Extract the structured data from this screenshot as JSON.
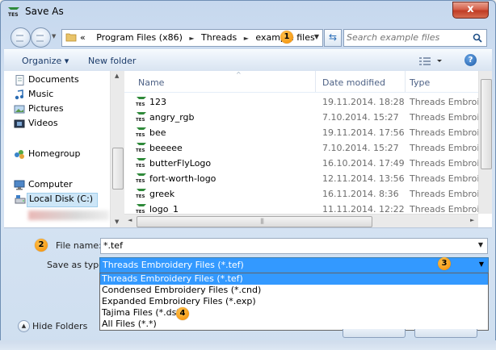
{
  "window": {
    "title": "Save As",
    "close_label": "x"
  },
  "address": {
    "overflow": "«",
    "crumbs": [
      "Program Files (x86)",
      "Threads",
      "example files"
    ],
    "separator": "►"
  },
  "search": {
    "placeholder": "Search example files"
  },
  "toolbar": {
    "organize": "Organize ▾",
    "new_folder": "New folder",
    "help": "?"
  },
  "nav": {
    "items": [
      {
        "label": "Documents",
        "icon": "documents-icon"
      },
      {
        "label": "Music",
        "icon": "music-icon"
      },
      {
        "label": "Pictures",
        "icon": "pictures-icon"
      },
      {
        "label": "Videos",
        "icon": "videos-icon"
      },
      {
        "label": "Homegroup",
        "icon": "homegroup-icon"
      },
      {
        "label": "Computer",
        "icon": "computer-icon"
      },
      {
        "label": "Local Disk (C:)",
        "icon": "local-disk-icon"
      }
    ]
  },
  "columns": {
    "name": "Name",
    "date": "Date modified",
    "type": "Type"
  },
  "files": [
    {
      "name": "123",
      "date": "19.11.2014. 18:28",
      "type": "Threads Embroide"
    },
    {
      "name": "angry_rgb",
      "date": "7.10.2014. 15:27",
      "type": "Threads Embroide"
    },
    {
      "name": "bee",
      "date": "19.11.2014. 17:56",
      "type": "Threads Embroide"
    },
    {
      "name": "beeeee",
      "date": "7.10.2014. 15:27",
      "type": "Threads Embroide"
    },
    {
      "name": "butterFlyLogo",
      "date": "16.10.2014. 17:49",
      "type": "Threads Embroide"
    },
    {
      "name": "fort-worth-logo",
      "date": "12.11.2014. 13:56",
      "type": "Threads Embroide"
    },
    {
      "name": "greek",
      "date": "16.11.2014. 8:36",
      "type": "Threads Embroide"
    },
    {
      "name": "logo_1",
      "date": "11.11.2014. 12:22",
      "type": "Threads Embroide"
    }
  ],
  "form": {
    "file_name_label": "File name:",
    "file_name_value": "*.tef",
    "save_type_label": "Save as type:",
    "save_type_value": "Threads Embroidery Files (*.tef)",
    "type_options": [
      "Threads Embroidery Files (*.tef)",
      "Condensed Embroidery Files (*.cnd)",
      "Expanded Embroidery Files (*.exp)",
      "Tajima Files (*.dst)",
      "All Files (*.*)"
    ],
    "selected_option_index": 0
  },
  "footer": {
    "hide_folders": "Hide Folders"
  },
  "callouts": [
    "1",
    "2",
    "3",
    "4"
  ],
  "colors": {
    "selection": "#3399ff",
    "callout": "#f7a21b",
    "close_button": "#c8432b"
  }
}
